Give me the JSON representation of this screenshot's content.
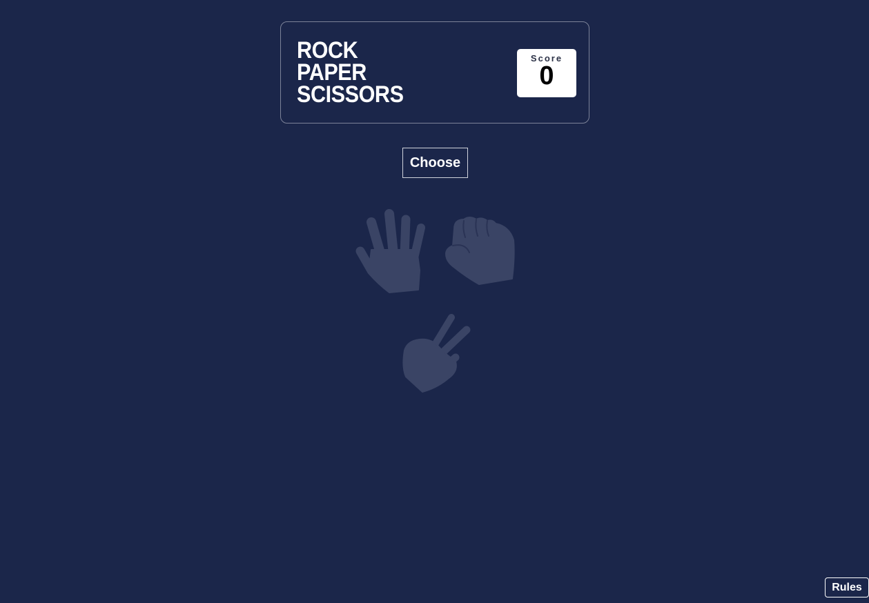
{
  "header": {
    "title_lines": [
      "ROCK",
      "PAPER",
      "SCISSORS"
    ],
    "score": {
      "label": "Score",
      "value": "0"
    }
  },
  "main": {
    "choose_label": "Choose",
    "choices": [
      {
        "name": "paper",
        "icon": "paper-hand-icon"
      },
      {
        "name": "rock",
        "icon": "rock-fist-icon"
      },
      {
        "name": "scissors",
        "icon": "scissors-hand-icon"
      }
    ],
    "hand_color": "#3a4465"
  },
  "footer": {
    "rules_label": "Rules"
  },
  "colors": {
    "background": "#1b264a",
    "text": "#ffffff",
    "score_box": "#ffffff"
  }
}
